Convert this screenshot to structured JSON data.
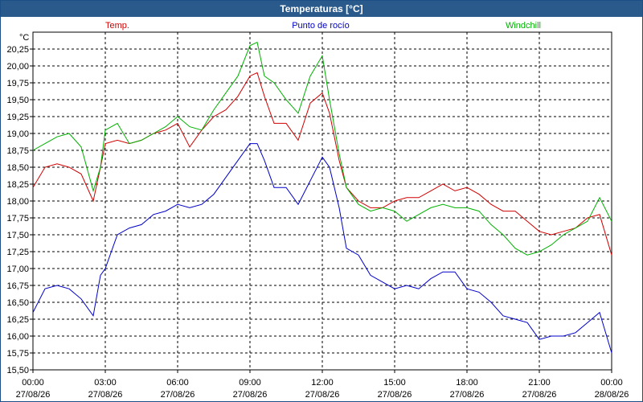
{
  "window": {
    "title": "Temperaturas [°C]"
  },
  "chart_data": {
    "type": "line",
    "title": "Temperaturas [°C]",
    "ylabel": "°C",
    "ylim": [
      15.5,
      20.5
    ],
    "yticks": [
      "15,50",
      "15,75",
      "16,00",
      "16,25",
      "16,50",
      "16,75",
      "17,00",
      "17,25",
      "17,50",
      "17,75",
      "18,00",
      "18,25",
      "18,50",
      "18,75",
      "19,00",
      "19,25",
      "19,50",
      "19,75",
      "20,00",
      "20,25"
    ],
    "xlim_hours": [
      0,
      24
    ],
    "xticks": [
      {
        "time": "00:00",
        "date": "27/08/26"
      },
      {
        "time": "03:00",
        "date": "27/08/26"
      },
      {
        "time": "06:00",
        "date": "27/08/26"
      },
      {
        "time": "09:00",
        "date": "27/08/26"
      },
      {
        "time": "12:00",
        "date": "27/08/26"
      },
      {
        "time": "15:00",
        "date": "27/08/26"
      },
      {
        "time": "18:00",
        "date": "27/08/26"
      },
      {
        "time": "21:00",
        "date": "27/08/26"
      },
      {
        "time": "00:00",
        "date": "28/08/26"
      }
    ],
    "grid": true,
    "series": [
      {
        "name": "Temp.",
        "color": "#d00000",
        "legend_position": "left",
        "x": [
          0,
          0.5,
          1,
          1.5,
          2,
          2.5,
          2.8,
          3,
          3.5,
          4,
          4.5,
          5,
          5.5,
          6,
          6.5,
          7,
          7.5,
          8,
          8.5,
          9,
          9.3,
          9.6,
          10,
          10.5,
          11,
          11.5,
          12,
          12.3,
          12.7,
          13,
          13.5,
          14,
          14.5,
          15,
          15.5,
          16,
          16.5,
          17,
          17.5,
          18,
          18.5,
          19,
          19.5,
          20,
          20.5,
          21,
          21.5,
          22,
          22.5,
          23,
          23.5,
          24
        ],
        "y": [
          18.2,
          18.5,
          18.55,
          18.5,
          18.4,
          18.0,
          18.5,
          18.85,
          18.9,
          18.85,
          18.9,
          19.0,
          19.05,
          19.15,
          18.8,
          19.05,
          19.25,
          19.35,
          19.55,
          19.85,
          19.9,
          19.55,
          19.15,
          19.15,
          18.9,
          19.45,
          19.6,
          19.3,
          18.6,
          18.2,
          18.0,
          17.9,
          17.9,
          18.0,
          18.05,
          18.05,
          18.15,
          18.25,
          18.15,
          18.2,
          18.1,
          17.95,
          17.85,
          17.85,
          17.7,
          17.55,
          17.5,
          17.55,
          17.6,
          17.75,
          17.8,
          17.2
        ]
      },
      {
        "name": "Punto de rocío",
        "color": "#0000c8",
        "legend_position": "center",
        "x": [
          0,
          0.5,
          1,
          1.5,
          2,
          2.5,
          2.8,
          3,
          3.5,
          4,
          4.5,
          5,
          5.5,
          6,
          6.5,
          7,
          7.5,
          8,
          8.5,
          9,
          9.3,
          9.6,
          10,
          10.5,
          11,
          11.5,
          12,
          12.3,
          12.7,
          13,
          13.5,
          14,
          14.5,
          15,
          15.5,
          16,
          16.5,
          17,
          17.5,
          18,
          18.5,
          19,
          19.5,
          20,
          20.5,
          21,
          21.5,
          22,
          22.5,
          23,
          23.5,
          24
        ],
        "y": [
          16.35,
          16.7,
          16.75,
          16.7,
          16.55,
          16.3,
          16.9,
          17.0,
          17.5,
          17.6,
          17.65,
          17.8,
          17.85,
          17.95,
          17.9,
          17.95,
          18.1,
          18.35,
          18.6,
          18.85,
          18.85,
          18.6,
          18.2,
          18.2,
          17.95,
          18.3,
          18.65,
          18.5,
          17.9,
          17.3,
          17.2,
          16.9,
          16.8,
          16.7,
          16.75,
          16.7,
          16.85,
          16.95,
          16.95,
          16.7,
          16.65,
          16.5,
          16.3,
          16.25,
          16.2,
          15.95,
          16.0,
          16.0,
          16.05,
          16.2,
          16.35,
          15.75
        ]
      },
      {
        "name": "Windchill",
        "color": "#00b000",
        "legend_position": "right",
        "x": [
          0,
          0.5,
          1,
          1.5,
          2,
          2.5,
          2.8,
          3,
          3.5,
          4,
          4.5,
          5,
          5.5,
          6,
          6.5,
          7,
          7.5,
          8,
          8.5,
          9,
          9.3,
          9.6,
          10,
          10.5,
          11,
          11.5,
          12,
          12.3,
          12.7,
          13,
          13.5,
          14,
          14.5,
          15,
          15.5,
          16,
          16.5,
          17,
          17.5,
          18,
          18.5,
          19,
          19.5,
          20,
          20.5,
          21,
          21.5,
          22,
          22.5,
          23,
          23.5,
          24
        ],
        "y": [
          18.75,
          18.85,
          18.95,
          19.0,
          18.8,
          18.15,
          18.5,
          19.05,
          19.15,
          18.85,
          18.9,
          19.0,
          19.1,
          19.25,
          19.1,
          19.05,
          19.35,
          19.6,
          19.85,
          20.3,
          20.35,
          19.85,
          19.75,
          19.5,
          19.3,
          19.85,
          20.15,
          19.5,
          18.7,
          18.2,
          17.95,
          17.85,
          17.9,
          17.85,
          17.7,
          17.8,
          17.9,
          17.95,
          17.9,
          17.9,
          17.85,
          17.65,
          17.5,
          17.3,
          17.2,
          17.25,
          17.35,
          17.5,
          17.6,
          17.7,
          18.05,
          17.7
        ]
      }
    ]
  }
}
